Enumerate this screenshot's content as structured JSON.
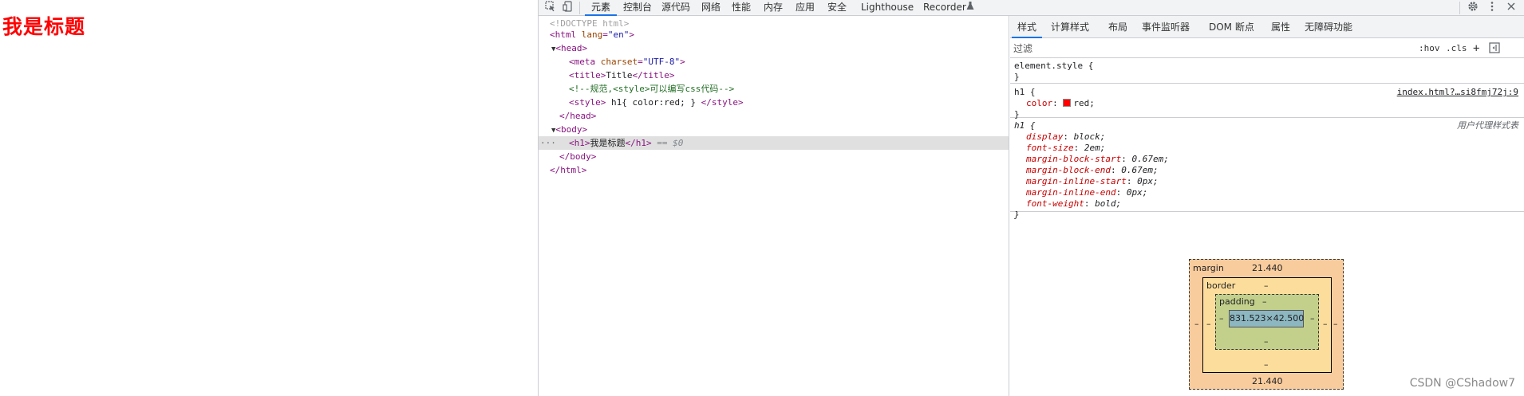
{
  "page": {
    "h1_text": "我是标题"
  },
  "toolbar": {
    "tabs": [
      "元素",
      "控制台",
      "源代码",
      "网络",
      "性能",
      "内存",
      "应用",
      "安全",
      "Lighthouse",
      "Recorder"
    ],
    "active_tab": "元素",
    "icons": [
      "inspect-element-icon",
      "device-toolbar-icon",
      "recorder-flask-icon",
      "settings-gear-icon",
      "more-vertical-icon"
    ]
  },
  "elements": {
    "doctype": "<!DOCTYPE html>",
    "html_open_tag": "html",
    "html_lang_attr": "lang",
    "html_lang_val": "\"en\"",
    "head_tag": "head",
    "meta_tag": "meta",
    "meta_attr": "charset",
    "meta_val": "\"UTF-8\"",
    "title_tag": "title",
    "title_text": "Title",
    "comment": "<!--规范,<style>可以编写css代码-->",
    "style_tag": "style",
    "style_text": " h1{ color:red; } ",
    "head_close": "</head>",
    "body_tag": "body",
    "h1_tag": "h1",
    "h1_text": "我是标题",
    "h1_hint": "== $0",
    "body_close": "</body>",
    "html_close": "</html>"
  },
  "styles": {
    "sub_tabs": [
      "样式",
      "计算样式",
      "布局",
      "事件监听器",
      "DOM 断点",
      "属性",
      "无障碍功能"
    ],
    "active_sub_tab": "样式",
    "filter_placeholder": "过滤",
    "hov_label": ":hov",
    "cls_label": ".cls",
    "plus_label": "+",
    "rules": [
      {
        "selector": "element.style {",
        "close": "}"
      },
      {
        "selector": "h1 {",
        "origin": "index.html?…si8fmj72j:9",
        "props": [
          {
            "name": "color",
            "value": "red;"
          }
        ],
        "close": "}",
        "swatch_color": "#ff0000"
      },
      {
        "selector": "h1 {",
        "origin": "用户代理样式表",
        "props": [
          {
            "name": "display",
            "value": "block;"
          },
          {
            "name": "font-size",
            "value": "2em;"
          },
          {
            "name": "margin-block-start",
            "value": "0.67em;"
          },
          {
            "name": "margin-block-end",
            "value": "0.67em;"
          },
          {
            "name": "margin-inline-start",
            "value": "0px;"
          },
          {
            "name": "margin-inline-end",
            "value": "0px;"
          },
          {
            "name": "font-weight",
            "value": "bold;"
          }
        ],
        "close": "}"
      }
    ]
  },
  "box_model": {
    "margin_label": "margin",
    "margin_top": "21.440",
    "margin_bottom": "21.440",
    "border_label": "border",
    "padding_label": "padding",
    "content": "831.523×42.500",
    "dash": "–",
    "colors": {
      "margin": "#f9cc9d",
      "border": "#fddd9b",
      "padding": "#c3d08b",
      "content": "#8cb6c0"
    }
  },
  "watermark": "CSDN @CShadow7"
}
